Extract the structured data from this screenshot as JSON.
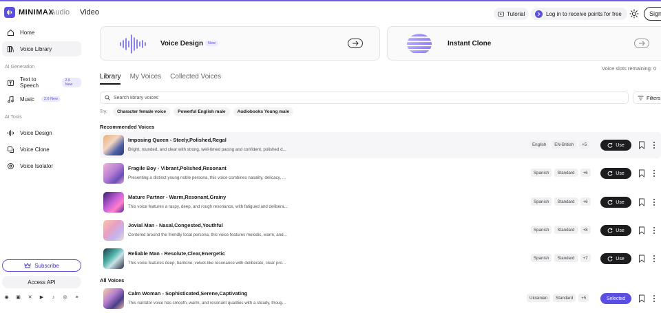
{
  "header": {
    "brand": "MINIMAX",
    "brand_sub": "Audio",
    "nav_video": "Video",
    "tutorial": "Tutorial",
    "login": "Log in to receive points for free",
    "signin": "Sign"
  },
  "sidebar": {
    "items": [
      {
        "label": "Home",
        "icon": "home-icon"
      },
      {
        "label": "Voice Library",
        "icon": "library-icon"
      }
    ],
    "section_ai_generation": "AI Generation",
    "gen_items": [
      {
        "label": "Text to Speech",
        "badge": "2.6 New"
      },
      {
        "label": "Music",
        "badge": "2.6 New"
      }
    ],
    "section_ai_tools": "AI Tools",
    "tool_items": [
      {
        "label": "Voice Design"
      },
      {
        "label": "Voice Clone"
      },
      {
        "label": "Voice Isolator"
      }
    ],
    "subscribe": "Subscribe",
    "access_api": "Access API"
  },
  "cards": {
    "voice_design": {
      "title": "Voice Design",
      "badge": "New"
    },
    "instant_clone": {
      "title": "Instant Clone"
    }
  },
  "tabs": [
    {
      "label": "Library"
    },
    {
      "label": "My Voices"
    },
    {
      "label": "Collected Voices"
    }
  ],
  "slots_text": "Voice slots remaining: 0",
  "search": {
    "placeholder": "Search library voices",
    "filters": "Filters"
  },
  "try": {
    "label": "Try:",
    "chips": [
      "Character female voice",
      "Powerful English male",
      "Audiobooks Young male"
    ]
  },
  "recommended_title": "Recommended Voices",
  "all_title": "All Voices",
  "voices": [
    {
      "name": "Imposing Queen - Steely,Polished,Regal",
      "desc": "Bright, rounded, and clear with strong, well-timed pacing and confident, polished d...",
      "tags": [
        "English",
        "EN-British"
      ],
      "more": "+5",
      "action": "Use"
    },
    {
      "name": "Fragile Boy - Vibrant,Polished,Resonant",
      "desc": "Presenting a distinct young noble persona, this voice combines nasality, delicacy, ...",
      "tags": [
        "Spanish",
        "Standard"
      ],
      "more": "+6",
      "action": "Use"
    },
    {
      "name": "Mature Partner - Warm,Resonant,Grainy",
      "desc": "This voice features a raspy, deep, and rough resonance, with fatigued and delibera...",
      "tags": [
        "Spanish",
        "Standard"
      ],
      "more": "+6",
      "action": "Use"
    },
    {
      "name": "Jovial Man - Nasal,Congested,Youthful",
      "desc": "Centered around the friendly local persona, this voice features melodic, warm, and...",
      "tags": [
        "Spanish",
        "Standard"
      ],
      "more": "+8",
      "action": "Use"
    },
    {
      "name": "Reliable Man - Resolute,Clear,Energetic",
      "desc": "This voice features deep, baritone, velvet-like resonance with deliberate, clear pro...",
      "tags": [
        "Spanish",
        "Standard"
      ],
      "more": "+7",
      "action": "Use"
    }
  ],
  "all_voices": [
    {
      "name": "Calm Woman - Sophisticated,Serene,Captivating",
      "desc": "This narrator voice has smooth, warm, and resonant qualities with a steady, thoug...",
      "tags": [
        "Ukrainian",
        "Standard"
      ],
      "more": "+5",
      "action": "Selected"
    }
  ],
  "colors": {
    "accent": "#5b4ee3",
    "button_dark": "#1d1d1f"
  }
}
